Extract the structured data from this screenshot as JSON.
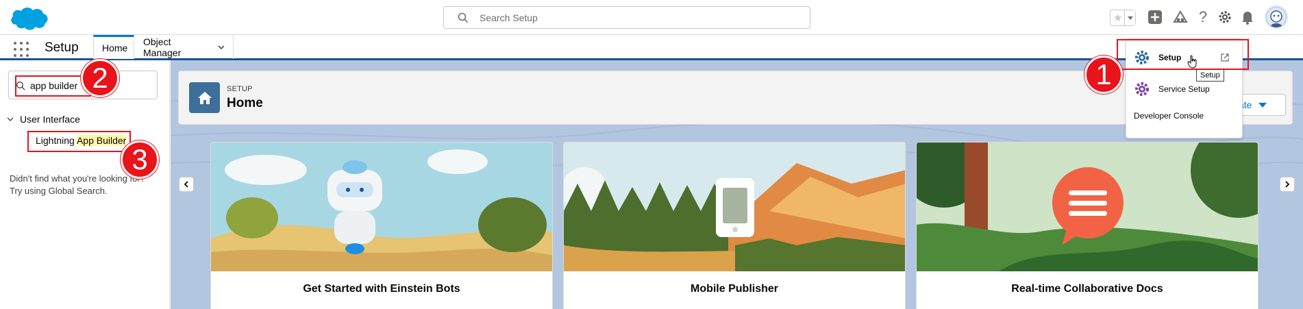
{
  "header": {
    "search_placeholder": "Search Setup"
  },
  "nav": {
    "app_name": "Setup",
    "tabs": [
      {
        "label": "Home"
      },
      {
        "label": "Object Manager"
      }
    ]
  },
  "sidebar": {
    "quick_find_value": "app builder",
    "tree_parent": "User Interface",
    "tree_child_prefix": "Lightning ",
    "tree_child_highlight": "App Builder",
    "no_match_line1": "Didn't find what you're looking for?",
    "no_match_line2": "Try using Global Search."
  },
  "page": {
    "kicker": "SETUP",
    "title": "Home",
    "create_label": "ate"
  },
  "cards": [
    {
      "title": "Get Started with Einstein Bots"
    },
    {
      "title": "Mobile Publisher"
    },
    {
      "title": "Real-time Collaborative Docs"
    }
  ],
  "setup_menu": {
    "items": [
      {
        "label": "Setup"
      },
      {
        "label": "Service Setup"
      },
      {
        "label": "Developer Console"
      }
    ],
    "tooltip": "Setup"
  },
  "annotations": {
    "badge1": "1",
    "badge2": "2",
    "badge3": "3",
    "color": "#e9131a"
  },
  "colors": {
    "brand_blue": "#0176d3",
    "nav_border": "#1b5297",
    "main_bg": "#b0c3df"
  }
}
